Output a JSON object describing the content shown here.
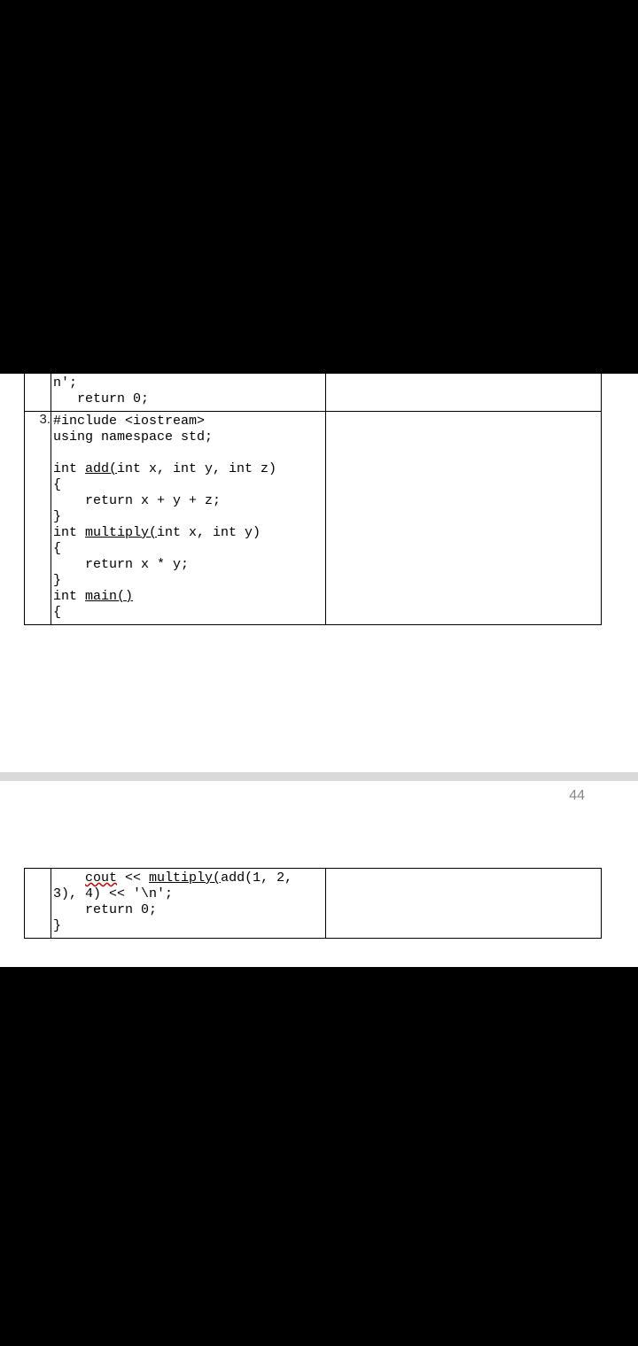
{
  "page_number": "44",
  "table_top": {
    "row1": {
      "num": "",
      "frag_line1": "n';",
      "indent_return0": "   return 0;"
    },
    "row2": {
      "num": "3.",
      "include": "#include <iostream>",
      "using": "using namespace std;",
      "blank1": "",
      "add_sig_pre": "int ",
      "add_sig_fn": "add(",
      "add_sig_post": "int x, int y, int z)",
      "brace_open1": "{",
      "add_body": "    return x + y + z;",
      "brace_close1": "}",
      "mul_sig_pre": "int ",
      "mul_sig_fn": "multiply(",
      "mul_sig_post": "int x, int y)",
      "brace_open2": "{",
      "mul_body": "    return x * y;",
      "brace_close2": "}",
      "main_sig_pre": "int ",
      "main_sig_fn": "main()",
      "brace_open3": "{",
      "blank2": ""
    }
  },
  "table_bottom": {
    "row1": {
      "num": "",
      "l1_pre": "    ",
      "l1_cout": "cout",
      "l1_mid": " << ",
      "l1_call": "multiply(",
      "l1_post": "add(1, 2,",
      "l2": "3), 4) << '\\n';",
      "l3": "    return 0;",
      "l4": "}"
    }
  }
}
